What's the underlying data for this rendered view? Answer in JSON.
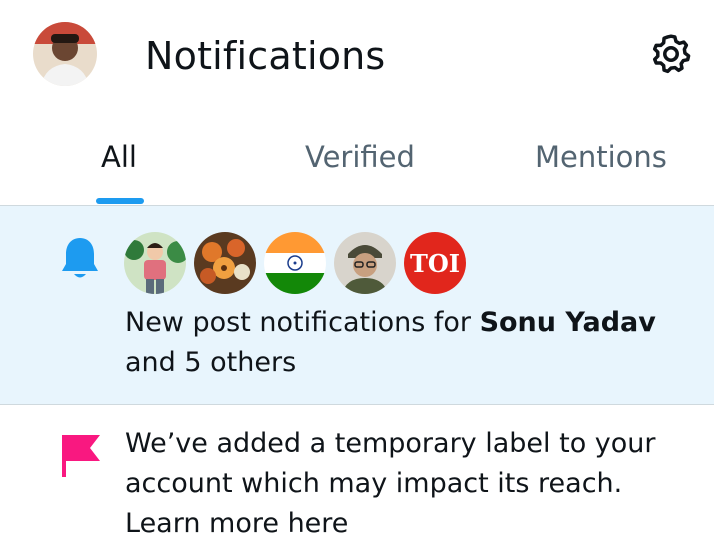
{
  "header": {
    "title": "Notifications",
    "avatar_icon": "profile-avatar",
    "settings_icon": "gear-icon"
  },
  "tabs": [
    {
      "label": "All",
      "active": true
    },
    {
      "label": "Verified",
      "active": false
    },
    {
      "label": "Mentions",
      "active": false
    }
  ],
  "notifications": [
    {
      "type": "new-post",
      "icon": "bell-icon",
      "avatars": [
        "sonu-yadav-avatar",
        "flowers-avatar",
        "india-flag-avatar",
        "soldier-avatar",
        "toi-avatar"
      ],
      "toi_text": "TOI",
      "text_prefix": "New post notifications for ",
      "text_bold": "Sonu Yadav",
      "text_suffix": "and 5 others"
    },
    {
      "type": "label-warning",
      "icon": "flag-icon",
      "line1": "We’ve added a temporary label to your",
      "line2": "account which may impact its reach.",
      "link": "Learn more here"
    }
  ],
  "colors": {
    "accent": "#1d9bf0",
    "highlight_bg": "#e8f5fd",
    "flag": "#f91880",
    "secondary_text": "#536471"
  }
}
